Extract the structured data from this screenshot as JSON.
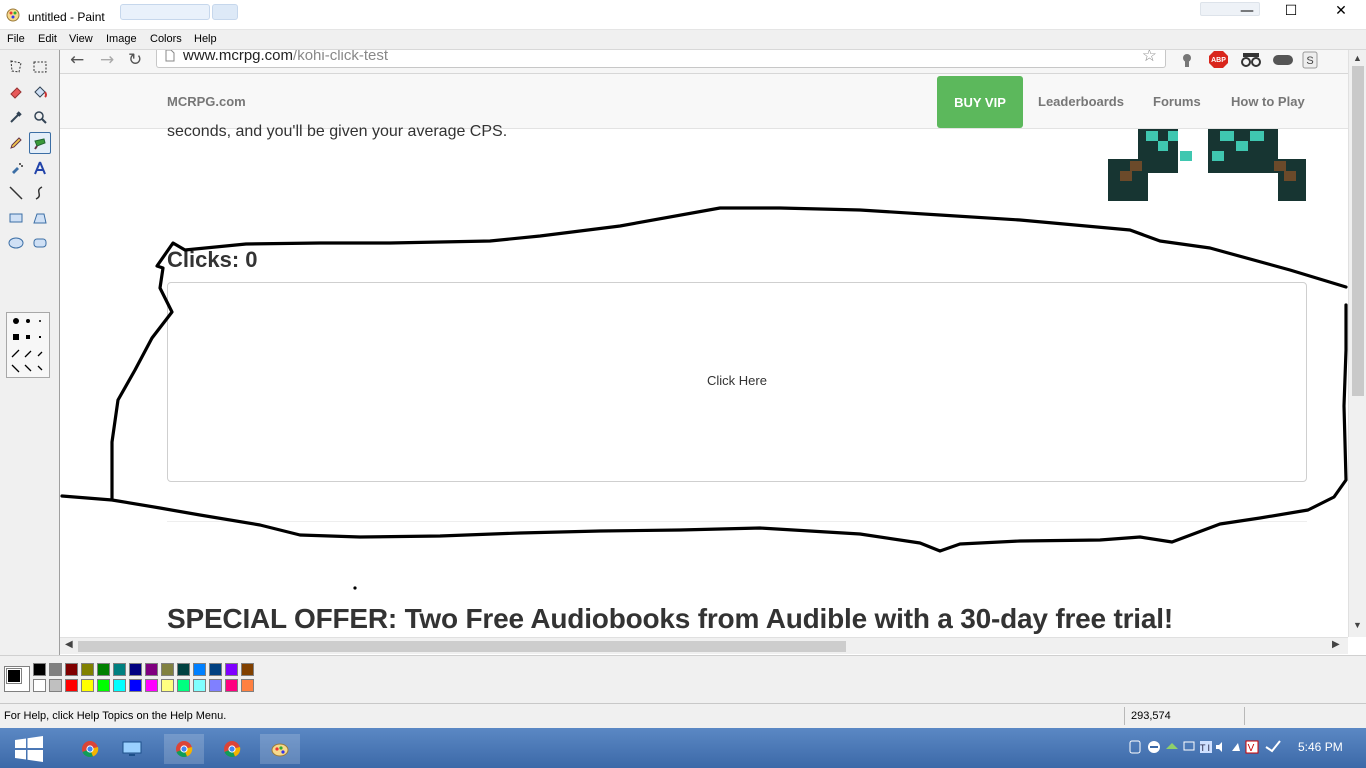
{
  "window": {
    "title": "untitled - Paint",
    "minimize": "—",
    "maximize": "☐",
    "close": "✕"
  },
  "menu": [
    "File",
    "Edit",
    "View",
    "Image",
    "Colors",
    "Help"
  ],
  "tools": [
    "free-select",
    "rect-select",
    "eraser",
    "fill",
    "color-picker",
    "magnifier",
    "pencil",
    "brush",
    "airbrush",
    "text",
    "line",
    "curve",
    "rectangle",
    "polygon",
    "ellipse",
    "rounded-rectangle"
  ],
  "selected_tool": "brush",
  "browser": {
    "back": "←",
    "forward": "→",
    "reload": "↻",
    "url_host": "www.mcrpg.com",
    "url_path": "/kohi-click-test",
    "star": "☆"
  },
  "site": {
    "brand": "MCRPG.com",
    "buy_vip": "BUY VIP",
    "nav": [
      "Leaderboards",
      "Forums",
      "How to Play"
    ],
    "intro": "seconds, and you'll be given your average CPS.",
    "clicks_label": "Clicks: 0",
    "click_here": "Click Here",
    "offer": "SPECIAL OFFER: Two Free Audiobooks from Audible with a 30-day free trial!"
  },
  "palette": {
    "foreground": "#000000",
    "background": "#ffffff",
    "colors_row1": [
      "#000000",
      "#808080",
      "#800000",
      "#808000",
      "#008000",
      "#008080",
      "#000080",
      "#800080",
      "#808040",
      "#004040",
      "#0080ff",
      "#004080",
      "#8000ff",
      "#804000"
    ],
    "colors_row2": [
      "#ffffff",
      "#c0c0c0",
      "#ff0000",
      "#ffff00",
      "#00ff00",
      "#00ffff",
      "#0000ff",
      "#ff00ff",
      "#ffff80",
      "#00ff80",
      "#80ffff",
      "#8080ff",
      "#ff0080",
      "#ff8040"
    ]
  },
  "status": {
    "help": "For Help, click Help Topics on the Help Menu.",
    "coords": "293,574"
  },
  "taskbar": {
    "apps": [
      "chrome",
      "desktop",
      "chrome",
      "chrome",
      "paint"
    ],
    "active_index": 2,
    "clock": "5:46 PM"
  }
}
